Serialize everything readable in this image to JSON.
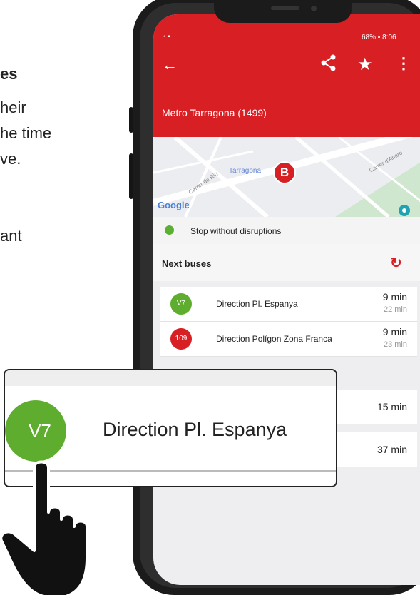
{
  "left_text": {
    "line1": "es",
    "line2": "heir",
    "line3": "he time",
    "line4": "ve.",
    "line5": "ant"
  },
  "status_bar": {
    "left": "◦ ▪",
    "right": "68% ▪ 8:06"
  },
  "app_bar": {
    "back_icon": "arrow-left-icon",
    "share_icon": "share-icon",
    "star_icon": "star-icon",
    "more_icon": "more-vertical-icon",
    "stop_title": "Metro Tarragona (1499)"
  },
  "map": {
    "place_label": "Tarragona",
    "street1": "Carrer de Riu",
    "street2": "Carrer d'Anaro",
    "google": "Google",
    "marker_letter": "B"
  },
  "stop_status": {
    "text": "Stop without disruptions",
    "color": "#5bb031"
  },
  "next_buses": {
    "title": "Next buses",
    "refresh_icon": "refresh-icon",
    "rows": [
      {
        "line": "V7",
        "color": "#5fad2f",
        "direction": "Direction Pl. Espanya",
        "time": "9 min",
        "next": "22 min"
      },
      {
        "line": "109",
        "color": "#d71f24",
        "direction": "Direction Polígon Zona Franca",
        "time": "9 min",
        "next": "23 min"
      },
      {
        "line": "",
        "color": "#cccccc",
        "direction": "",
        "time": "15 min",
        "next": ""
      },
      {
        "line": "",
        "color": "#cccccc",
        "direction": "",
        "time": "37 min",
        "next": ""
      }
    ]
  },
  "callout": {
    "line": "V7",
    "direction": "Direction Pl. Espanya",
    "color": "#5fad2f"
  },
  "colors": {
    "accent": "#d71f24",
    "phone_body": "#1b1b1b"
  }
}
